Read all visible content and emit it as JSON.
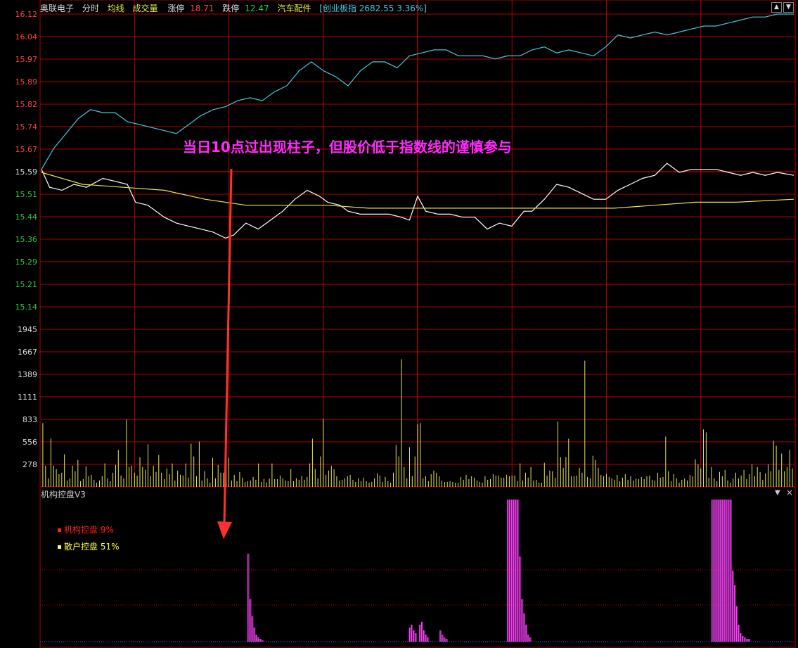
{
  "header": {
    "stock_name": "奥联电子",
    "tabs": [
      "分时",
      "均线",
      "成交量"
    ],
    "limit_up_label": "涨停",
    "limit_up_value": "18.71",
    "limit_down_label": "跌停",
    "limit_down_value": "12.47",
    "sector": "汽车配件",
    "index_info": "[创业板指 2682.55 3.36%]"
  },
  "annotation": "当日10点过出现柱子，但股价低于指数线的谨慎参与",
  "indicator": {
    "title": "机构控盘V3",
    "legend": [
      {
        "label": "机构控盘 9%",
        "color": "#ff2020"
      },
      {
        "label": "散户控盘 51%",
        "color": "#ffff40"
      }
    ]
  },
  "colors": {
    "grid": "#b00000",
    "price_line": "#ffffff",
    "avg_line": "#e8e84a",
    "index_line": "#40c8e0",
    "volume_bar": "#e8e84a",
    "indicator_bar": "#ff40ff",
    "up_label": "#ff4040",
    "down_label": "#20d040",
    "arrow": "#ff3030"
  },
  "chart_data": [
    {
      "type": "line",
      "name": "intraday-price",
      "y_ticks": [
        "16.12",
        "16.04",
        "15.97",
        "15.89",
        "15.82",
        "15.74",
        "15.67",
        "15.59",
        "15.51",
        "15.44",
        "15.36",
        "15.29",
        "15.21",
        "15.14"
      ],
      "prev_close": 15.59,
      "ylim": [
        15.14,
        16.12
      ],
      "x_range_minutes": [
        0,
        240
      ],
      "series": [
        {
          "name": "price",
          "points": [
            [
              0,
              15.6
            ],
            [
              4,
              15.54
            ],
            [
              10,
              15.53
            ],
            [
              16,
              15.55
            ],
            [
              22,
              15.54
            ],
            [
              30,
              15.57
            ],
            [
              36,
              15.56
            ],
            [
              42,
              15.55
            ],
            [
              46,
              15.49
            ],
            [
              52,
              15.48
            ],
            [
              60,
              15.44
            ],
            [
              66,
              15.42
            ],
            [
              72,
              15.41
            ],
            [
              78,
              15.4
            ],
            [
              84,
              15.39
            ],
            [
              90,
              15.37
            ],
            [
              94,
              15.38
            ],
            [
              100,
              15.42
            ],
            [
              106,
              15.4
            ],
            [
              112,
              15.43
            ],
            [
              118,
              15.46
            ],
            [
              124,
              15.5
            ],
            [
              130,
              15.53
            ],
            [
              136,
              15.51
            ],
            [
              140,
              15.49
            ],
            [
              146,
              15.48
            ],
            [
              150,
              15.46
            ],
            [
              156,
              15.45
            ],
            [
              162,
              15.45
            ],
            [
              170,
              15.45
            ],
            [
              176,
              15.44
            ],
            [
              180,
              15.43
            ],
            [
              184,
              15.51
            ],
            [
              188,
              15.46
            ],
            [
              194,
              15.45
            ],
            [
              200,
              15.45
            ],
            [
              206,
              15.44
            ],
            [
              212,
              15.44
            ],
            [
              218,
              15.4
            ],
            [
              224,
              15.42
            ],
            [
              230,
              15.41
            ],
            [
              236,
              15.46
            ],
            [
              240,
              15.46
            ],
            [
              246,
              15.5
            ],
            [
              252,
              15.55
            ],
            [
              258,
              15.54
            ],
            [
              264,
              15.52
            ],
            [
              270,
              15.5
            ],
            [
              276,
              15.5
            ],
            [
              282,
              15.53
            ],
            [
              288,
              15.55
            ],
            [
              294,
              15.57
            ],
            [
              300,
              15.58
            ],
            [
              306,
              15.62
            ],
            [
              312,
              15.59
            ],
            [
              318,
              15.6
            ],
            [
              324,
              15.6
            ],
            [
              330,
              15.6
            ],
            [
              336,
              15.59
            ],
            [
              342,
              15.58
            ],
            [
              348,
              15.59
            ],
            [
              354,
              15.58
            ],
            [
              360,
              15.59
            ],
            [
              368,
              15.58
            ]
          ]
        },
        {
          "name": "avg",
          "points": [
            [
              0,
              15.59
            ],
            [
              20,
              15.55
            ],
            [
              40,
              15.54
            ],
            [
              60,
              15.53
            ],
            [
              80,
              15.5
            ],
            [
              100,
              15.48
            ],
            [
              120,
              15.48
            ],
            [
              140,
              15.48
            ],
            [
              160,
              15.47
            ],
            [
              180,
              15.47
            ],
            [
              200,
              15.47
            ],
            [
              220,
              15.47
            ],
            [
              240,
              15.47
            ],
            [
              260,
              15.47
            ],
            [
              280,
              15.47
            ],
            [
              300,
              15.48
            ],
            [
              320,
              15.49
            ],
            [
              340,
              15.49
            ],
            [
              368,
              15.5
            ]
          ]
        },
        {
          "name": "index",
          "points": [
            [
              0,
              15.6
            ],
            [
              6,
              15.67
            ],
            [
              12,
              15.72
            ],
            [
              18,
              15.77
            ],
            [
              24,
              15.8
            ],
            [
              30,
              15.79
            ],
            [
              36,
              15.79
            ],
            [
              42,
              15.76
            ],
            [
              48,
              15.75
            ],
            [
              54,
              15.74
            ],
            [
              60,
              15.73
            ],
            [
              66,
              15.72
            ],
            [
              72,
              15.75
            ],
            [
              78,
              15.78
            ],
            [
              84,
              15.8
            ],
            [
              90,
              15.81
            ],
            [
              96,
              15.83
            ],
            [
              102,
              15.84
            ],
            [
              108,
              15.83
            ],
            [
              114,
              15.86
            ],
            [
              120,
              15.88
            ],
            [
              126,
              15.93
            ],
            [
              132,
              15.96
            ],
            [
              138,
              15.93
            ],
            [
              144,
              15.91
            ],
            [
              150,
              15.88
            ],
            [
              156,
              15.93
            ],
            [
              162,
              15.96
            ],
            [
              168,
              15.96
            ],
            [
              174,
              15.94
            ],
            [
              180,
              15.98
            ],
            [
              186,
              15.99
            ],
            [
              192,
              16.0
            ],
            [
              198,
              16.0
            ],
            [
              204,
              15.98
            ],
            [
              210,
              15.98
            ],
            [
              216,
              15.98
            ],
            [
              222,
              15.97
            ],
            [
              228,
              15.98
            ],
            [
              234,
              15.98
            ],
            [
              240,
              16.0
            ],
            [
              246,
              16.01
            ],
            [
              252,
              15.99
            ],
            [
              258,
              16.0
            ],
            [
              264,
              15.99
            ],
            [
              270,
              15.98
            ],
            [
              276,
              16.01
            ],
            [
              282,
              16.05
            ],
            [
              288,
              16.04
            ],
            [
              294,
              16.05
            ],
            [
              300,
              16.06
            ],
            [
              306,
              16.05
            ],
            [
              312,
              16.06
            ],
            [
              318,
              16.07
            ],
            [
              324,
              16.08
            ],
            [
              330,
              16.08
            ],
            [
              336,
              16.09
            ],
            [
              342,
              16.1
            ],
            [
              348,
              16.11
            ],
            [
              354,
              16.11
            ],
            [
              360,
              16.12
            ],
            [
              368,
              16.12
            ]
          ]
        }
      ]
    },
    {
      "type": "bar",
      "name": "volume",
      "y_ticks": [
        "1945",
        "1667",
        "1389",
        "1111",
        "833",
        "556",
        "278"
      ],
      "ylim": [
        0,
        2223
      ],
      "values": [
        900,
        300,
        120,
        680,
        300,
        250,
        180,
        200,
        460,
        90,
        120,
        300,
        220,
        380,
        80,
        110,
        290,
        150,
        170,
        100,
        60,
        90,
        150,
        330,
        120,
        80,
        200,
        310,
        520,
        160,
        120,
        950,
        280,
        300,
        200,
        160,
        420,
        280,
        240,
        600,
        150,
        300,
        210,
        450,
        200,
        110,
        260,
        180,
        330,
        90,
        230,
        170,
        160,
        330,
        130,
        610,
        430,
        150,
        640,
        90,
        220,
        120,
        60,
        410,
        120,
        310,
        200,
        200,
        600,
        410,
        90,
        170,
        80,
        210,
        130,
        70,
        80,
        90,
        140,
        100,
        330,
        70,
        110,
        60,
        120,
        330,
        110,
        110,
        160,
        120,
        90,
        80,
        250,
        80,
        120,
        100,
        150,
        100,
        140,
        330,
        680,
        250,
        120,
        430,
        960,
        170,
        230,
        300,
        250,
        150,
        90,
        100,
        120,
        150,
        170,
        100,
        70,
        120,
        80,
        130,
        80,
        60,
        70,
        120,
        190,
        160,
        70,
        140,
        80,
        60,
        200,
        590,
        430,
        1800,
        280,
        120,
        560,
        150,
        430,
        880,
        900,
        120,
        150,
        80,
        180,
        230,
        200,
        150,
        90,
        70,
        70,
        80,
        70,
        60,
        60,
        140,
        100,
        170,
        110,
        150,
        130,
        90,
        70,
        60,
        150,
        100,
        110,
        180,
        160,
        160,
        130,
        130,
        170,
        150,
        160,
        160,
        80,
        330,
        90,
        200,
        130,
        280,
        90,
        100,
        60,
        60,
        340,
        160,
        230,
        220,
        130,
        920,
        420,
        270,
        420,
        680,
        150,
        150,
        160,
        270,
        200,
        1780,
        140,
        120,
        440,
        380,
        270,
        170,
        150,
        180,
        140,
        120,
        100,
        170,
        80,
        130,
        180,
        100,
        150,
        90,
        120,
        110,
        140,
        110,
        150,
        160,
        100,
        90,
        200,
        130,
        140,
        710,
        220,
        80,
        180,
        120,
        60,
        100,
        120,
        90,
        170,
        150,
        390,
        320,
        260,
        810,
        770,
        130,
        280,
        120,
        80,
        210,
        150,
        240,
        90,
        60,
        120,
        200,
        120,
        160,
        240,
        110,
        180,
        320,
        150,
        280,
        210,
        100,
        190,
        320,
        220,
        650,
        580,
        240,
        470,
        220,
        280,
        520,
        260
      ]
    },
    {
      "type": "bar",
      "name": "institutional-control",
      "series": [
        {
          "name": "机构控盘",
          "values": [
            [
              101,
              0.62
            ],
            [
              102,
              0.3
            ],
            [
              103,
              0.18
            ],
            [
              104,
              0.1
            ],
            [
              105,
              0.05
            ],
            [
              106,
              0.03
            ],
            [
              107,
              0.02
            ],
            [
              108,
              0.01
            ],
            [
              180,
              0.1
            ],
            [
              181,
              0.12
            ],
            [
              182,
              0.08
            ],
            [
              183,
              0.06
            ],
            [
              185,
              0.12
            ],
            [
              186,
              0.14
            ],
            [
              187,
              0.08
            ],
            [
              188,
              0.05
            ],
            [
              189,
              0.03
            ],
            [
              195,
              0.08
            ],
            [
              196,
              0.05
            ],
            [
              197,
              0.03
            ],
            [
              198,
              0.02
            ],
            [
              228,
              1.0
            ],
            [
              229,
              1.0
            ],
            [
              230,
              1.0
            ],
            [
              231,
              1.0
            ],
            [
              232,
              1.0
            ],
            [
              233,
              1.0
            ],
            [
              234,
              0.6
            ],
            [
              235,
              0.3
            ],
            [
              236,
              0.2
            ],
            [
              237,
              0.12
            ],
            [
              238,
              0.05
            ],
            [
              239,
              0.03
            ],
            [
              328,
              1.0
            ],
            [
              329,
              1.0
            ],
            [
              330,
              1.0
            ],
            [
              331,
              1.0
            ],
            [
              332,
              1.0
            ],
            [
              333,
              1.0
            ],
            [
              334,
              1.0
            ],
            [
              335,
              1.0
            ],
            [
              336,
              1.0
            ],
            [
              337,
              1.0
            ],
            [
              338,
              0.5
            ],
            [
              339,
              0.4
            ],
            [
              340,
              0.25
            ],
            [
              341,
              0.12
            ],
            [
              342,
              0.06
            ],
            [
              343,
              0.04
            ],
            [
              344,
              0.03
            ],
            [
              345,
              0.02
            ],
            [
              346,
              0.02
            ]
          ]
        }
      ]
    }
  ]
}
